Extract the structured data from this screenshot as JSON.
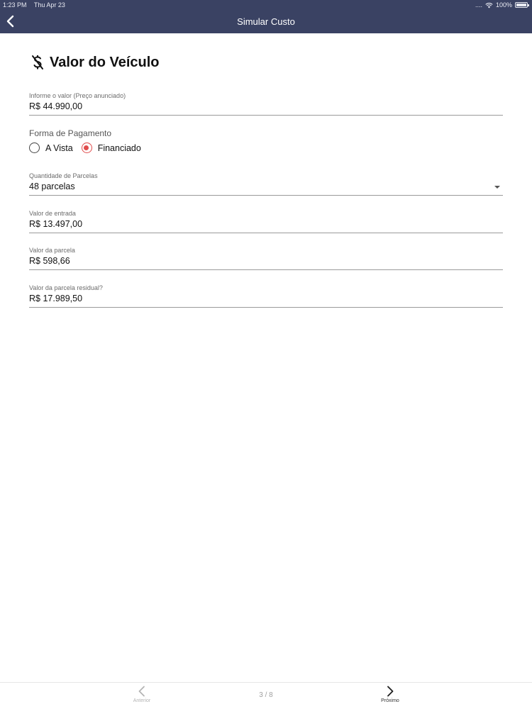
{
  "status_bar": {
    "time": "1:23 PM",
    "date": "Thu Apr 23",
    "signal": "....",
    "battery": "100%",
    "battery_level": 1.0
  },
  "nav_bar": {
    "title": "Simular Custo",
    "back_icon": "chevron-left-icon"
  },
  "section": {
    "title": "Valor do Veículo",
    "icon": "dollar-off-icon"
  },
  "fields": {
    "price": {
      "label": "Informe o valor (Preço anunciado)",
      "value": "R$ 44.990,00"
    },
    "payment": {
      "label": "Forma de Pagamento",
      "options": [
        "A Vista",
        "Financiado"
      ],
      "selected": "Financiado"
    },
    "installments": {
      "label": "Quantidade de Parcelas",
      "value": "48 parcelas"
    },
    "down_payment": {
      "label": "Valor de entrada",
      "value": "R$ 13.497,00"
    },
    "installment_value": {
      "label": "Valor da parcela",
      "value": "R$ 598,66"
    },
    "residual": {
      "label": "Valor da parcela residual?",
      "value": "R$ 17.989,50"
    }
  },
  "footer": {
    "prev_label": "Anterior",
    "next_label": "Próximo",
    "page_indicator": "3 / 8"
  },
  "colors": {
    "header": "#3a4263",
    "accent": "#e04c4c"
  }
}
